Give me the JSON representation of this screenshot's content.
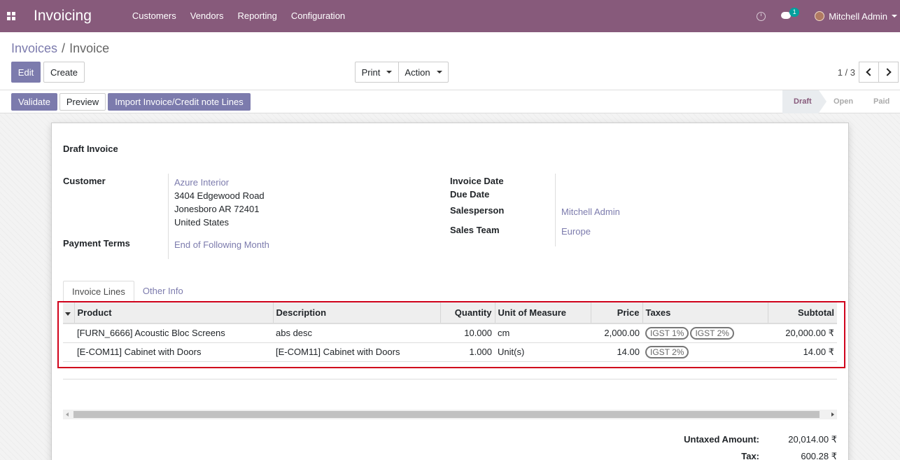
{
  "navbar": {
    "brand": "Invoicing",
    "menu": [
      "Customers",
      "Vendors",
      "Reporting",
      "Configuration"
    ],
    "messages_count": "1",
    "user_name": "Mitchell Admin",
    "color": "#875a7b"
  },
  "control": {
    "breadcrumb_parent": "Invoices",
    "breadcrumb_sep": "/",
    "breadcrumb_current": "Invoice",
    "edit_label": "Edit",
    "create_label": "Create",
    "print_label": "Print",
    "action_label": "Action",
    "pager": "1 / 3"
  },
  "statusbar": {
    "validate_label": "Validate",
    "preview_label": "Preview",
    "import_label": "Import Invoice/Credit note Lines",
    "stages": [
      "Draft",
      "Open",
      "Paid"
    ],
    "active_stage": "Draft"
  },
  "invoice": {
    "title": "Draft Invoice",
    "customer_label": "Customer",
    "customer_name": "Azure Interior",
    "address_line1": "3404 Edgewood Road",
    "address_line2": "Jonesboro AR 72401",
    "address_line3": "United States",
    "payment_terms_label": "Payment Terms",
    "payment_terms": "End of Following Month",
    "invoice_date_label": "Invoice Date",
    "due_date_label": "Due Date",
    "salesperson_label": "Salesperson",
    "salesperson": "Mitchell Admin",
    "sales_team_label": "Sales Team",
    "sales_team": "Europe"
  },
  "tabs": [
    "Invoice Lines",
    "Other Info"
  ],
  "lines_table": {
    "headers": [
      "Product",
      "Description",
      "Quantity",
      "Unit of Measure",
      "Price",
      "Taxes",
      "Subtotal"
    ],
    "rows": [
      {
        "product": "[FURN_6666] Acoustic Bloc Screens",
        "description": "abs desc",
        "quantity": "10.000",
        "uom": "cm",
        "price": "2,000.00",
        "taxes": [
          "IGST 1%",
          "IGST 2%"
        ],
        "subtotal": "20,000.00 ₹"
      },
      {
        "product": "[E-COM11] Cabinet with Doors",
        "description": "[E-COM11] Cabinet with Doors",
        "quantity": "1.000",
        "uom": "Unit(s)",
        "price": "14.00",
        "taxes": [
          "IGST 2%"
        ],
        "subtotal": "14.00 ₹"
      }
    ]
  },
  "totals": {
    "untaxed_label": "Untaxed Amount:",
    "untaxed_value": "20,014.00 ₹",
    "tax_label": "Tax:",
    "tax_value": "600.28 ₹"
  }
}
